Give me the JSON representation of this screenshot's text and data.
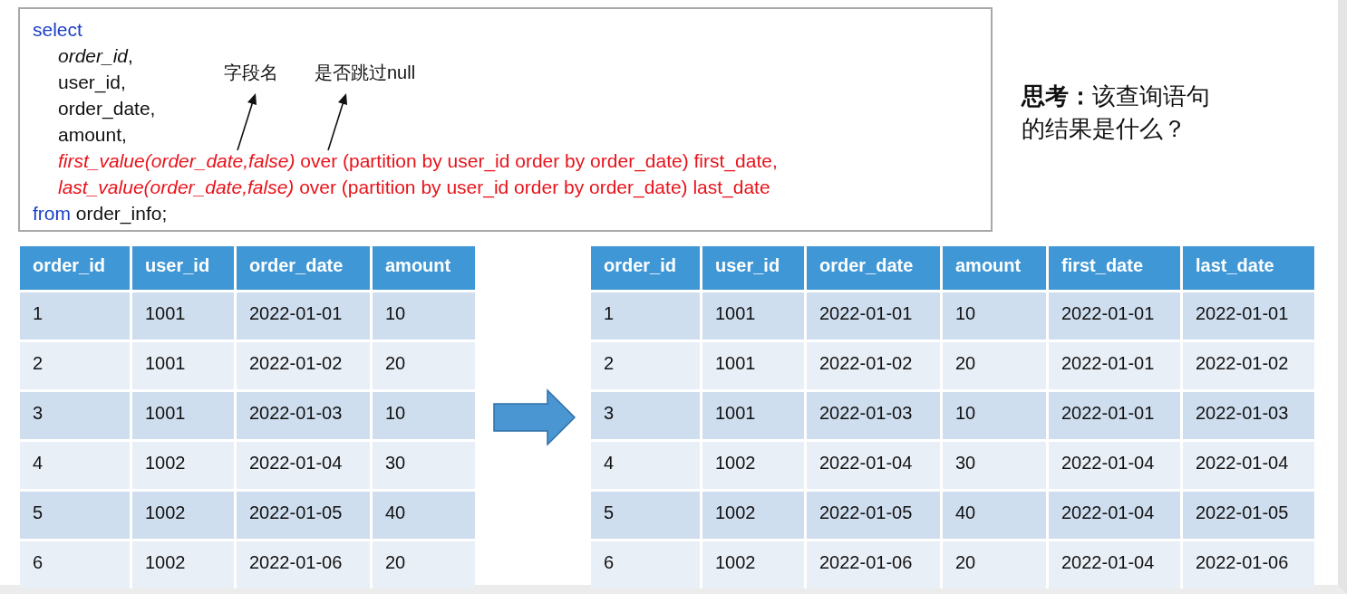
{
  "code": {
    "lines": [
      {
        "segments": [
          {
            "kind": "keyword",
            "text": "select"
          }
        ],
        "children": [
          {
            "segments": [
              {
                "kind": "italic",
                "text": "order_id"
              },
              {
                "kind": "plain",
                "text": ","
              }
            ]
          },
          {
            "segments": [
              {
                "kind": "plain",
                "text": "user_id,"
              }
            ]
          },
          {
            "segments": [
              {
                "kind": "plain",
                "text": "order_date,"
              }
            ]
          },
          {
            "segments": [
              {
                "kind": "plain",
                "text": "amount,"
              }
            ]
          },
          {
            "segments": [
              {
                "kind": "red_italic",
                "text": "first_value(order_date,false)"
              },
              {
                "kind": "red",
                "text": " over (partition by user_id order by order_date) first_date,"
              }
            ]
          },
          {
            "segments": [
              {
                "kind": "red_italic",
                "text": "last_value(order_date,false)"
              },
              {
                "kind": "red",
                "text": " over (partition by user_id order by order_date) last_date"
              }
            ]
          }
        ]
      },
      {
        "segments": [
          {
            "kind": "keyword",
            "text": "from"
          },
          {
            "kind": "plain",
            "text": " order_info;"
          }
        ]
      }
    ],
    "annotations": [
      {
        "text": "字段名"
      },
      {
        "text": "是否跳过null"
      }
    ]
  },
  "question": "**思考：**该查询语句的结果是什么？",
  "input_table": {
    "columns": [
      "order_id",
      "user_id",
      "order_date",
      "amount"
    ],
    "rows": [
      [
        "1",
        "1001",
        "2022-01-01",
        "10"
      ],
      [
        "2",
        "1001",
        "2022-01-02",
        "20"
      ],
      [
        "3",
        "1001",
        "2022-01-03",
        "10"
      ],
      [
        "4",
        "1002",
        "2022-01-04",
        "30"
      ],
      [
        "5",
        "1002",
        "2022-01-05",
        "40"
      ],
      [
        "6",
        "1002",
        "2022-01-06",
        "20"
      ]
    ]
  },
  "output_table": {
    "columns": [
      "order_id",
      "user_id",
      "order_date",
      "amount",
      "first_date",
      "last_date"
    ],
    "rows": [
      [
        "1",
        "1001",
        "2022-01-01",
        "10",
        "2022-01-01",
        "2022-01-01"
      ],
      [
        "2",
        "1001",
        "2022-01-02",
        "20",
        "2022-01-01",
        "2022-01-02"
      ],
      [
        "3",
        "1001",
        "2022-01-03",
        "10",
        "2022-01-01",
        "2022-01-03"
      ],
      [
        "4",
        "1002",
        "2022-01-04",
        "30",
        "2022-01-04",
        "2022-01-04"
      ],
      [
        "5",
        "1002",
        "2022-01-05",
        "40",
        "2022-01-04",
        "2022-01-05"
      ],
      [
        "6",
        "1002",
        "2022-01-06",
        "20",
        "2022-01-04",
        "2022-01-06"
      ]
    ]
  }
}
